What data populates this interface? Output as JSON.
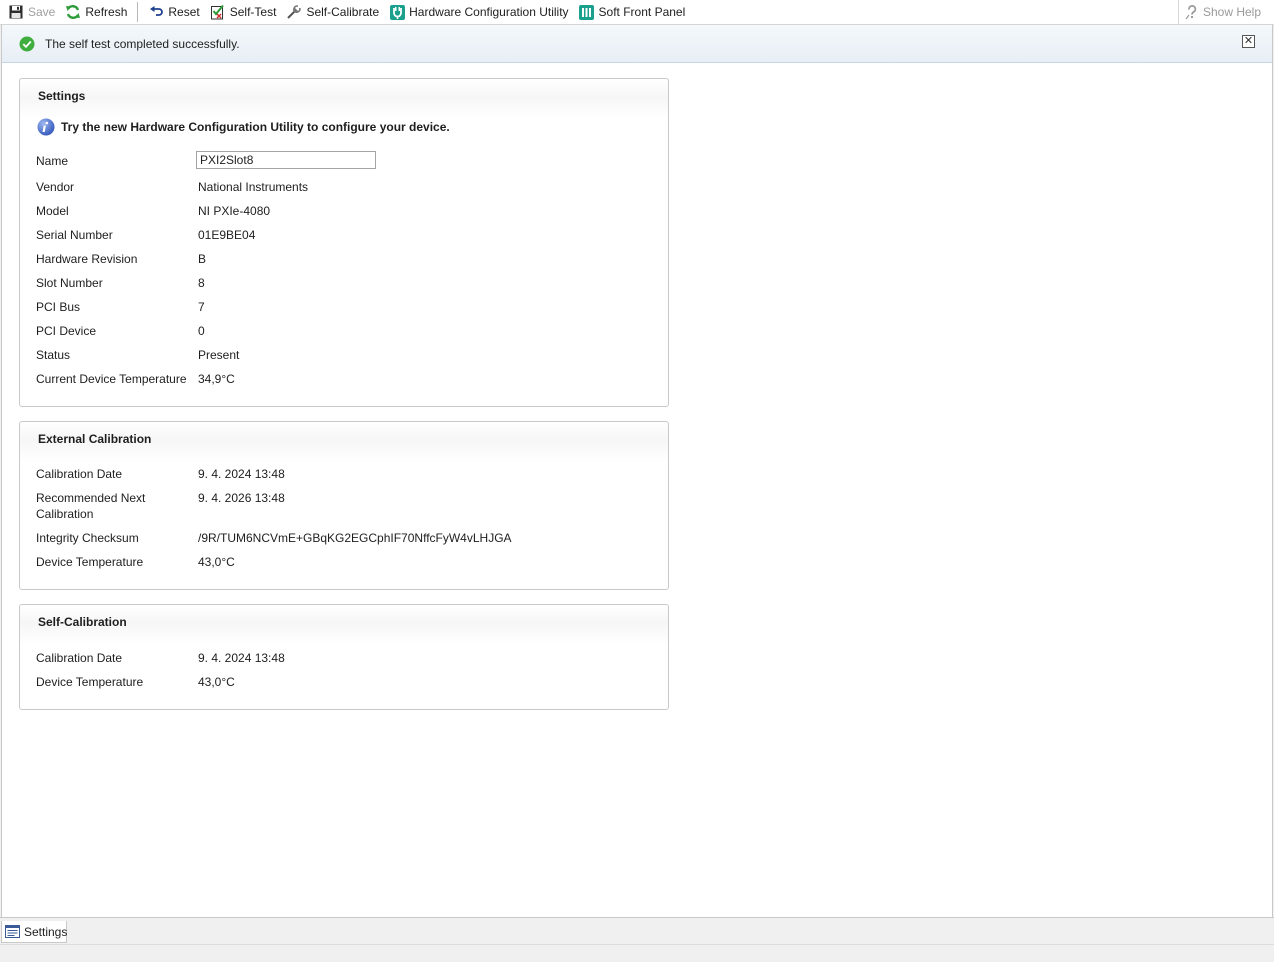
{
  "toolbar": {
    "save_label": "Save",
    "refresh_label": "Refresh",
    "reset_label": "Reset",
    "selftest_label": "Self-Test",
    "selfcalibrate_label": "Self-Calibrate",
    "hcu_label": "Hardware Configuration Utility",
    "sfp_label": "Soft Front Panel",
    "help_label": "Show Help"
  },
  "notification": {
    "message": "The self test completed successfully.",
    "close_glyph": "✕"
  },
  "settings": {
    "title": "Settings",
    "hint": "Try the new Hardware Configuration Utility to configure your device.",
    "rows": [
      {
        "label": "Name",
        "value": "PXI2Slot8"
      },
      {
        "label": "Vendor",
        "value": "National Instruments"
      },
      {
        "label": "Model",
        "value": "NI PXIe-4080"
      },
      {
        "label": "Serial Number",
        "value": "01E9BE04"
      },
      {
        "label": "Hardware Revision",
        "value": "B"
      },
      {
        "label": "Slot Number",
        "value": "8"
      },
      {
        "label": "PCI Bus",
        "value": "7"
      },
      {
        "label": "PCI Device",
        "value": "0"
      },
      {
        "label": "Status",
        "value": "Present"
      },
      {
        "label": "Current Device Temperature",
        "value": "34,9°C"
      }
    ]
  },
  "external_calibration": {
    "title": "External Calibration",
    "rows": [
      {
        "label": "Calibration Date",
        "value": "9. 4. 2024 13:48"
      },
      {
        "label": "Recommended Next Calibration",
        "value": "9. 4. 2026 13:48"
      },
      {
        "label": "Integrity Checksum",
        "value": "/9R/TUM6NCVmE+GBqKG2EGCphIF70NffcFyW4vLHJGA"
      },
      {
        "label": "Device Temperature",
        "value": "43,0°C"
      }
    ]
  },
  "self_calibration": {
    "title": "Self-Calibration",
    "rows": [
      {
        "label": "Calibration Date",
        "value": "9. 4. 2024 13:48"
      },
      {
        "label": "Device Temperature",
        "value": "43,0°C"
      }
    ]
  },
  "tabs": [
    {
      "label": "Settings"
    }
  ],
  "icons": {
    "save": "save-icon",
    "refresh": "refresh-icon",
    "reset": "reset-icon",
    "selftest": "self-test-icon",
    "selfcalibrate": "self-calibrate-icon",
    "hcu": "hardware-configuration-icon",
    "sfp": "soft-front-panel-icon",
    "help": "help-icon",
    "success": "success-check-icon",
    "info": "info-icon"
  },
  "colors": {
    "success_green": "#3fae3f",
    "teal_accent": "#1aa08c",
    "info_blue": "#3b62c9"
  }
}
